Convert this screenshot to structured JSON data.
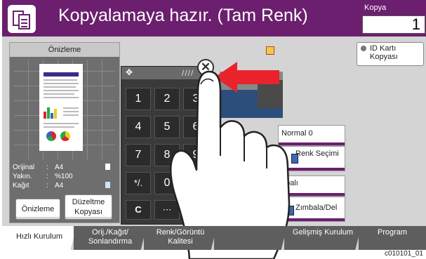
{
  "header": {
    "title": "Kopyalamaya hazır. (Tam Renk)",
    "copies_label": "Kopya",
    "copies_value": "1",
    "accent_color": "#6b1f6e"
  },
  "preview": {
    "heading": "Önizleme",
    "rows": [
      {
        "key": "Orijinal",
        "sep": ":",
        "value": "A4"
      },
      {
        "key": "Yakın.",
        "sep": ":",
        "value": "%100"
      },
      {
        "key": "Kağıt",
        "sep": ":",
        "value": "A4"
      }
    ],
    "preview_button": "Önizleme",
    "edit_button": "Düzeltme Kopyası"
  },
  "right_panel": {
    "id_card": "ID Kartı Kopyası",
    "normal": "Normal 0",
    "color_select": "Renk Seçimi",
    "staple_partial": "apalı",
    "staple_punch": "Zımbala/Del"
  },
  "keypad": {
    "keys": [
      "1",
      "2",
      "3",
      "4",
      "5",
      "6",
      "7",
      "8",
      "9",
      "*/.",
      "0",
      "#",
      "C",
      "⋯"
    ],
    "close_symbol": "✕"
  },
  "tabs": [
    {
      "label": "Hızlı Kurulum",
      "active": true
    },
    {
      "label": "Orij./Kağıt/ Sonlandırma",
      "active": false
    },
    {
      "label": "Renk/Görüntü Kalitesi",
      "active": false
    },
    {
      "label": "",
      "active": false
    },
    {
      "label": "Gelişmiş Kurulum",
      "active": false
    },
    {
      "label": "Program",
      "active": false
    }
  ],
  "reference": "c010101_01"
}
